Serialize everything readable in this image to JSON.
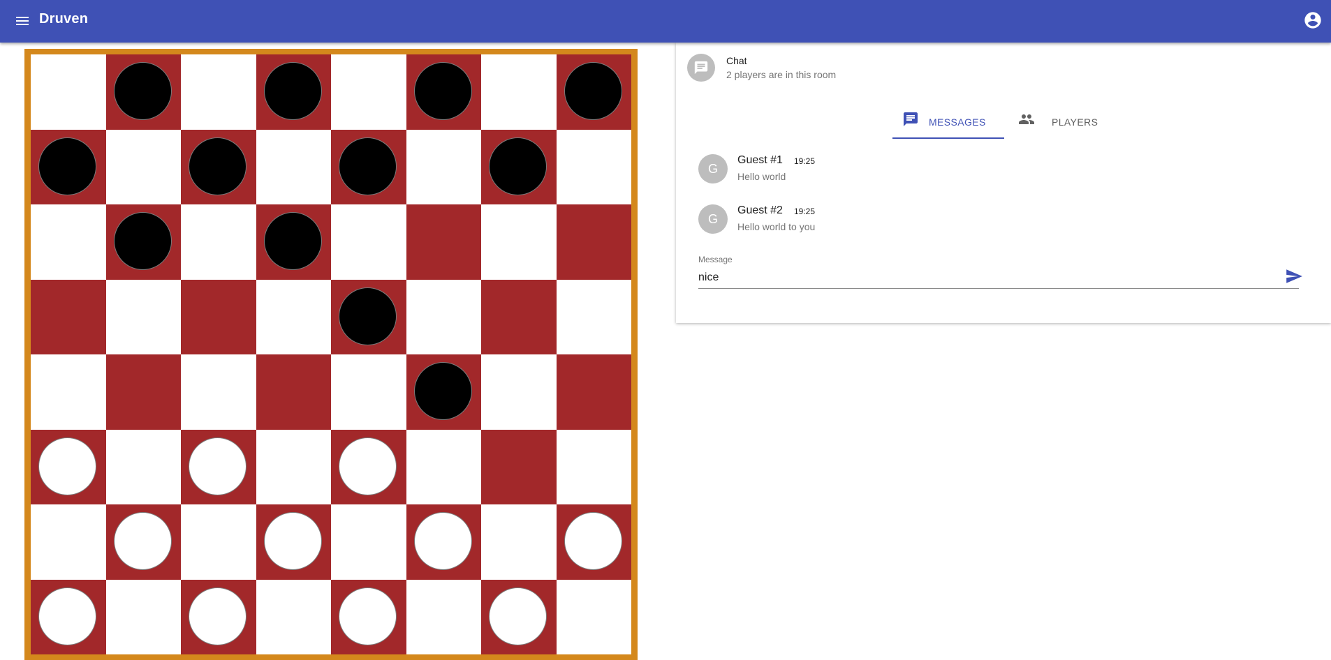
{
  "app": {
    "title": "Druven",
    "menu_icon": "menu-icon",
    "account_icon": "account-circle-icon",
    "primary_color": "#3f51b5"
  },
  "board": {
    "frame_color": "#d4881c",
    "dark_square_color": "#a2282a",
    "light_square_color": "#ffffff",
    "pieces": [
      [
        "",
        "black",
        "",
        "black",
        "",
        "black",
        "",
        "black"
      ],
      [
        "black",
        "",
        "black",
        "",
        "black",
        "",
        "black",
        ""
      ],
      [
        "",
        "black",
        "",
        "black",
        "",
        "",
        "",
        ""
      ],
      [
        "",
        "",
        "",
        "",
        "black",
        "",
        "",
        ""
      ],
      [
        "",
        "",
        "",
        "",
        "",
        "black",
        "",
        ""
      ],
      [
        "white",
        "",
        "white",
        "",
        "white",
        "",
        "",
        ""
      ],
      [
        "",
        "white",
        "",
        "white",
        "",
        "white",
        "",
        "white"
      ],
      [
        "white",
        "",
        "white",
        "",
        "white",
        "",
        "white",
        ""
      ]
    ]
  },
  "chat": {
    "title": "Chat",
    "subtitle": "2 players are in this room",
    "icon": "chat-icon",
    "tabs": [
      {
        "label": "MESSAGES",
        "icon": "message-icon",
        "active": true
      },
      {
        "label": "PLAYERS",
        "icon": "people-icon",
        "active": false
      }
    ],
    "messages": [
      {
        "avatar": "G",
        "name": "Guest #1",
        "time": "19:25",
        "text": "Hello world"
      },
      {
        "avatar": "G",
        "name": "Guest #2",
        "time": "19:25",
        "text": "Hello world to you"
      }
    ],
    "input": {
      "label": "Message",
      "value": "nice",
      "send_icon": "send-icon"
    }
  }
}
